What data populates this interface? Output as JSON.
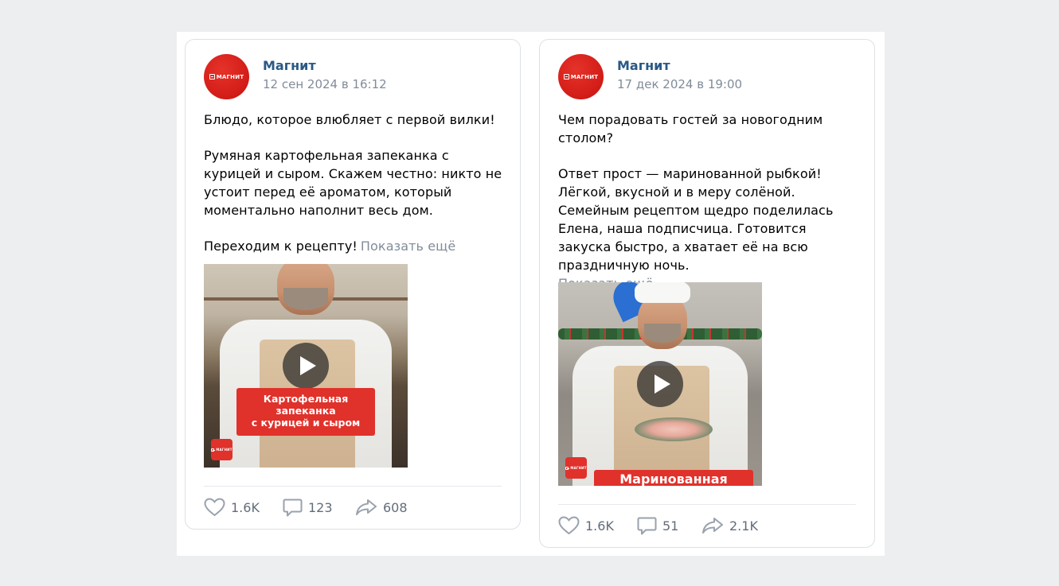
{
  "posts": [
    {
      "author": "Магнит",
      "date": "12 сен 2024 в 16:12",
      "avatar_logo": "МАГНИТ",
      "paragraphs": [
        "Блюдо, которое влюбляет с первой вилки!",
        "Румяная картофельная запеканка с курицей и сыром. Скажем честно: никто не устоит перед её ароматом, который моментально наполнит весь дом.",
        "Переходим к рецепту!"
      ],
      "show_more": "Показать ещё",
      "video": {
        "banner_lines": [
          "Картофельная",
          "запеканка",
          "с курицей и сыром"
        ],
        "corner_logo": "МАГНИТ"
      },
      "likes": "1.6K",
      "comments": "123",
      "shares": "608"
    },
    {
      "author": "Магнит",
      "date": "17 дек 2024 в 19:00",
      "avatar_logo": "МАГНИТ",
      "paragraphs": [
        "Чем порадовать гостей за новогодним столом?",
        "Ответ прост — маринованной рыбкой! Лёгкой, вкусной и в меру солёной. Семейным рецептом щедро поделилась Елена, наша подписчица. Готовится закуска быстро, а хватает её на всю праздничную ночь."
      ],
      "show_more": "Показать ещё",
      "video": {
        "banner_lines": [
          "Маринованная"
        ],
        "corner_logo": "МАГНИТ"
      },
      "likes": "1.6K",
      "comments": "51",
      "shares": "2.1K"
    }
  ],
  "icons": {
    "like": "heart-icon",
    "comment": "comment-icon",
    "share": "share-arrow-icon",
    "play": "play-icon"
  },
  "colors": {
    "brand_red": "#e0312b",
    "author_link": "#2a5885",
    "secondary_text": "#818c99"
  }
}
